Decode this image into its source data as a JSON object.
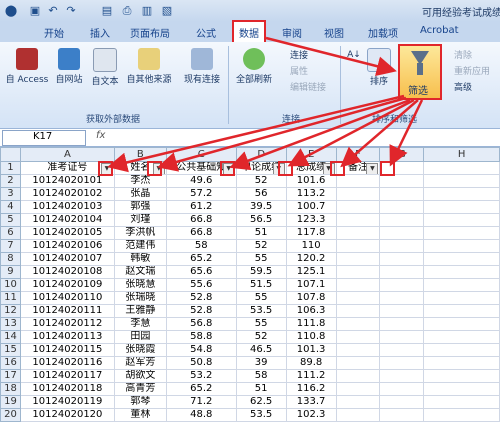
{
  "app": {
    "title": "可用经验考试成绩",
    "menu_icon": "office-logo-icon"
  },
  "quick_access": [
    "save-icon",
    "undo-icon",
    "redo-icon",
    "new-icon",
    "print-icon",
    "preview-icon",
    "open-icon"
  ],
  "tabs": [
    {
      "label": "开始"
    },
    {
      "label": "插入"
    },
    {
      "label": "页面布局"
    },
    {
      "label": "公式"
    },
    {
      "label": "数据",
      "active": true
    },
    {
      "label": "审阅"
    },
    {
      "label": "视图"
    },
    {
      "label": "加载项"
    },
    {
      "label": "Acrobat"
    }
  ],
  "ribbon": {
    "external": {
      "buttons": [
        "自 Access",
        "自网站",
        "自文本",
        "自其他来源",
        "现有连接"
      ],
      "group_label": "获取外部数据"
    },
    "connections": {
      "refresh_label": "全部刷新",
      "items": [
        "连接",
        "属性",
        "编辑链接"
      ],
      "group_label": "连接"
    },
    "sort_filter": {
      "sort_label": "排序",
      "filter_label": "筛选",
      "items": [
        "清除",
        "重新应用",
        "高级"
      ],
      "group_label": "排序和筛选"
    }
  },
  "formula_bar": {
    "name_box": "K17",
    "fx": "fx"
  },
  "sheet": {
    "columns": [
      "A",
      "B",
      "C",
      "D",
      "E",
      "F",
      "G",
      "H"
    ],
    "headers": [
      "准考证号",
      "姓名",
      "公共基础知",
      "申论成绩",
      "总成绩",
      "备注"
    ],
    "rows": [
      [
        "10124020101",
        "李杰",
        "49.6",
        "52",
        "101.6"
      ],
      [
        "10124020102",
        "张晶",
        "57.2",
        "56",
        "113.2"
      ],
      [
        "10124020103",
        "郭强",
        "61.2",
        "39.5",
        "100.7"
      ],
      [
        "10124020104",
        "刘瑾",
        "66.8",
        "56.5",
        "123.3"
      ],
      [
        "10124020105",
        "李洪帆",
        "66.8",
        "51",
        "117.8"
      ],
      [
        "10124020106",
        "范建伟",
        "58",
        "52",
        "110"
      ],
      [
        "10124020107",
        "韩敏",
        "65.2",
        "55",
        "120.2"
      ],
      [
        "10124020108",
        "赵文瑞",
        "65.6",
        "59.5",
        "125.1"
      ],
      [
        "10124020109",
        "张晓慧",
        "55.6",
        "51.5",
        "107.1"
      ],
      [
        "10124020110",
        "张瑞晓",
        "52.8",
        "55",
        "107.8"
      ],
      [
        "10124020111",
        "王雅静",
        "52.8",
        "53.5",
        "106.3"
      ],
      [
        "10124020112",
        "李慧",
        "56.8",
        "55",
        "111.8"
      ],
      [
        "10124020113",
        "田园",
        "58.8",
        "52",
        "110.8"
      ],
      [
        "10124020115",
        "张晓霞",
        "54.8",
        "46.5",
        "101.3"
      ],
      [
        "10124020116",
        "赵军芳",
        "50.8",
        "39",
        "89.8"
      ],
      [
        "10124020117",
        "胡欲文",
        "53.2",
        "58",
        "111.2"
      ],
      [
        "10124020118",
        "高青芳",
        "65.2",
        "51",
        "116.2"
      ],
      [
        "10124020119",
        "郭琴",
        "71.2",
        "62.5",
        "133.7"
      ],
      [
        "10124020120",
        "董林",
        "48.8",
        "53.5",
        "102.3"
      ]
    ]
  },
  "colors": {
    "highlight": "#e0262b",
    "ribbon": "#d4e3f6",
    "header": "#e4ecf7"
  }
}
